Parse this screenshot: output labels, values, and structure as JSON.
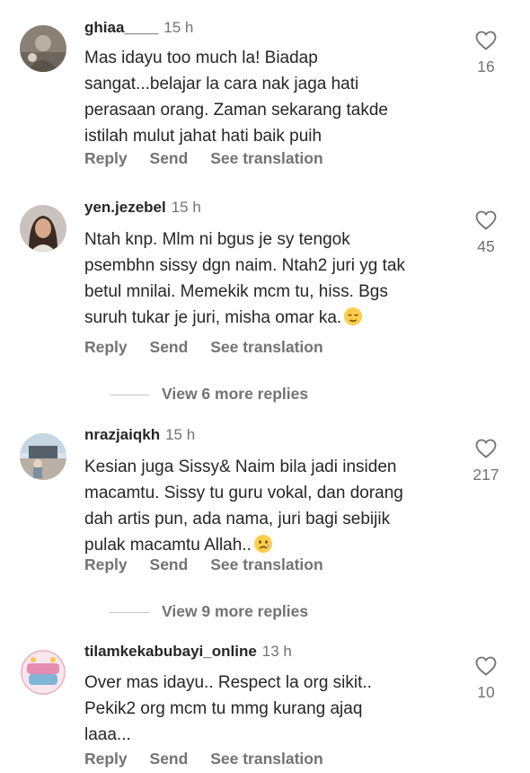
{
  "comments": [
    {
      "username": "ghiaa____",
      "time": "15 h",
      "text": "Mas idayu too much la! Biadap\nsangat...belajar la cara nak jaga hati\nperasaan orang. Zaman sekarang takde\nistilah mulut jahat hati baik puih",
      "likes": "16",
      "reply": "Reply",
      "send": "Send",
      "see_translation": "See translation"
    },
    {
      "username": "yen.jezebel",
      "time": "15 h",
      "text": "Ntah knp. Mlm ni bgus je sy tengok\npsembhn sissy dgn naim. Ntah2 juri yg tak\nbetul mnilai. Memekik mcm tu, hiss. Bgs\nsuruh tukar je juri, misha omar ka.",
      "emoji": "relieved-face-emoji",
      "likes": "45",
      "reply": "Reply",
      "send": "Send",
      "see_translation": "See translation",
      "view_more": "View 6 more replies"
    },
    {
      "username": "nrazjaiqkh",
      "time": "15 h",
      "text": "Kesian juga Sissy& Naim bila jadi insiden\nmacamtu. Sissy tu guru vokal, dan dorang\ndah artis pun, ada nama, juri bagi sebijik\npulak macamtu Allah..",
      "emoji": "sad-face-emoji",
      "likes": "217",
      "reply": "Reply",
      "send": "Send",
      "see_translation": "See translation",
      "view_more": "View 9 more replies"
    },
    {
      "username": "tilamkekabubayi_online",
      "time": "13 h",
      "text": "Over mas idayu.. Respect la org sikit..\nPekik2 org mcm tu mmg kurang ajaq\nlaaa...",
      "likes": "10",
      "reply": "Reply",
      "send": "Send",
      "see_translation": "See translation"
    }
  ],
  "colors": {
    "primary_text": "#262626",
    "secondary_text": "#737373",
    "background": "#ffffff"
  },
  "icons": {
    "like": "heart-outline-icon"
  }
}
